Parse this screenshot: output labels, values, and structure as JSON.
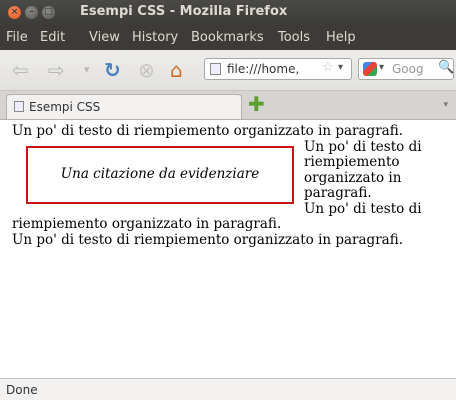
{
  "window": {
    "title": "Esempi CSS - Mozilla Firefox",
    "controls": {
      "close": "×",
      "minimize": "–",
      "maximize": "□"
    }
  },
  "menu": {
    "file": "File",
    "edit": "Edit",
    "view": "View",
    "history": "History",
    "bookmarks": "Bookmarks",
    "tools": "Tools",
    "help": "Help"
  },
  "nav": {
    "back": "⇦",
    "forward": "⇨",
    "dropdown": "▾",
    "reload": "↻",
    "stop": "⊗",
    "home": "⌂"
  },
  "url": {
    "value": "file:///home,",
    "star": "☆",
    "drop": "▾"
  },
  "search": {
    "drop": "▾",
    "placeholder": "Goog",
    "magnifier": "🔍"
  },
  "tabs": {
    "active_label": "Esempi CSS",
    "new_tab": "✚",
    "list": "▾"
  },
  "content": {
    "para1": "Un po' di testo di riempiemento organizzato in paragrafi.",
    "quote": "Una citazione da evidenziare",
    "para2": "Un po' di testo di riempiemento organizzato in paragrafi.",
    "para3": "Un po' di testo di riempiemento organizzato in paragrafi.",
    "para4": "Un po' di testo di riempiemento organizzato in paragrafi."
  },
  "status": {
    "text": "Done"
  },
  "colors": {
    "quote_border": "#cc1111",
    "titlebar": "#3c3b37",
    "close_button": "#e0531f"
  },
  "icons": {
    "back": "back-arrow-icon",
    "forward": "forward-arrow-icon",
    "reload": "reload-icon",
    "stop": "stop-icon",
    "home": "home-icon",
    "star": "bookmark-star-icon",
    "search": "magnifier-icon",
    "new_tab": "plus-icon"
  }
}
